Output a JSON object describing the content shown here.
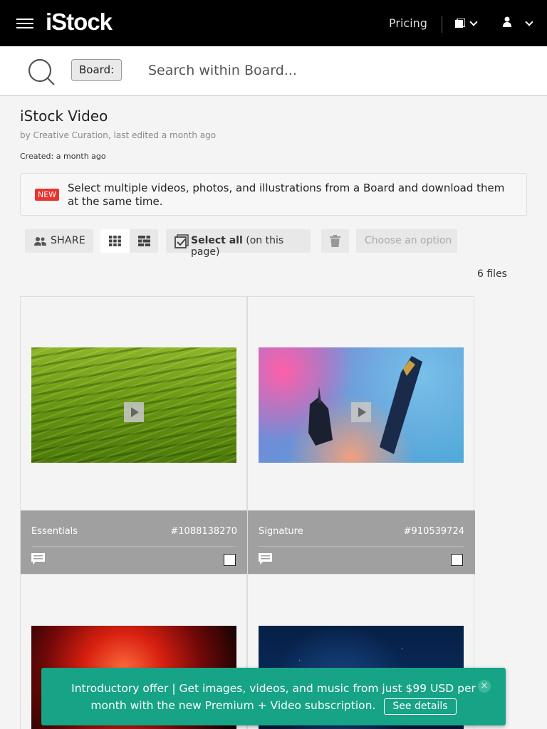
{
  "topnav": {
    "logo": "iStock",
    "pricing_label": "Pricing",
    "icons": [
      "hamburger-menu-icon",
      "boards-icon",
      "chevron-down-icon",
      "person-icon"
    ]
  },
  "search": {
    "scope_label": "Board:",
    "placeholder": "Search within Board..."
  },
  "board": {
    "title": "iStock Video",
    "byline": "by Creative Curation, last edited a month ago",
    "created": "Created: a month ago"
  },
  "notice": {
    "badge": "NEW",
    "text": "Select multiple videos, photos, and illustrations from a Board and download them at the same time."
  },
  "toolbar": {
    "share_label": "SHARE",
    "select_all_bold": "Select all",
    "select_all_rest": " (on this page)",
    "choose_placeholder": "Choose an option"
  },
  "files_count": "6 files",
  "assets": [
    {
      "collection": "Essentials",
      "id": "#1088138270",
      "media": "video",
      "selected": false
    },
    {
      "collection": "Signature",
      "id": "#910539724",
      "media": "video",
      "selected": false
    },
    {
      "collection": "",
      "id": "",
      "media": "video",
      "selected": false
    },
    {
      "collection": "",
      "id": "",
      "media": "video",
      "selected": false
    }
  ],
  "promo": {
    "text": "Introductory offer | Get images, videos, and music from just $99 USD per month with the new Premium + Video subscription.",
    "cta": "See details",
    "close": "×"
  },
  "colors": {
    "nav_bg": "#000000",
    "promo_bg": "#16a386",
    "new_badge": "#e8342e",
    "meta_bar": "#a0a0a0"
  }
}
